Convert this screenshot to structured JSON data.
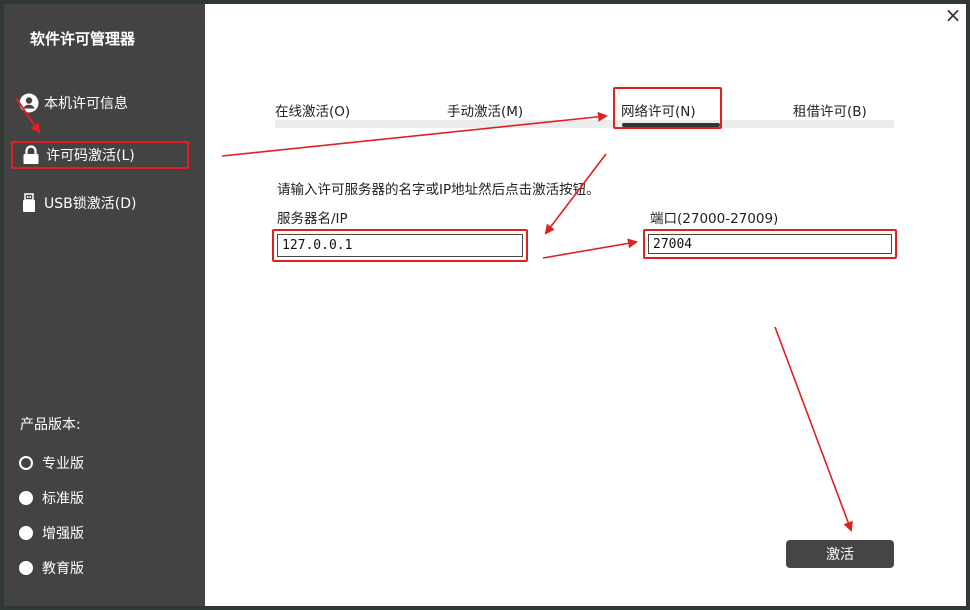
{
  "app": {
    "title": "软件许可管理器"
  },
  "sidebar": {
    "items": [
      {
        "label": "本机许可信息",
        "icon": "user-icon"
      },
      {
        "label": "许可码激活(L)",
        "icon": "lock-icon"
      },
      {
        "label": "USB锁激活(D)",
        "icon": "usb-icon"
      }
    ],
    "edition_title": "产品版本:",
    "editions": [
      {
        "label": "专业版",
        "selected": false
      },
      {
        "label": "标准版",
        "selected": true
      },
      {
        "label": "增强版",
        "selected": true
      },
      {
        "label": "教育版",
        "selected": true
      }
    ]
  },
  "tabs": [
    {
      "label": "在线激活(O)"
    },
    {
      "label": "手动激活(M)"
    },
    {
      "label": "网络许可(N)"
    },
    {
      "label": "租借许可(B)"
    }
  ],
  "form": {
    "instruction": "请输入许可服务器的名字或IP地址然后点击激活按钮。",
    "server_label": "服务器名/IP",
    "server_value": "127.0.0.1",
    "port_label": "端口(27000-27009)",
    "port_value": "27004"
  },
  "buttons": {
    "activate": "激活",
    "close": "×"
  },
  "colors": {
    "sidebar": "#434343",
    "annotation": "#e02020",
    "button": "#454545"
  }
}
